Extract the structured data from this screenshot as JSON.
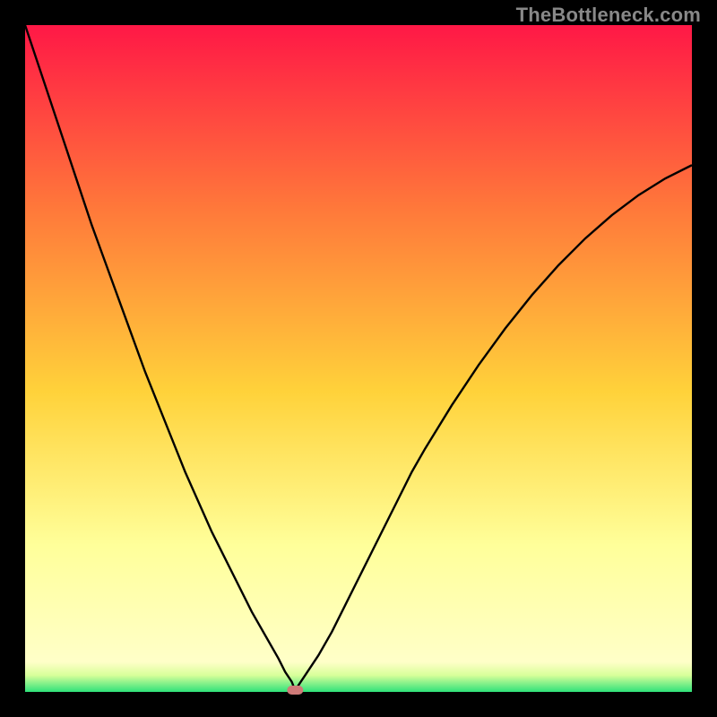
{
  "watermark": "TheBottleneck.com",
  "chart_data": {
    "type": "line",
    "title": "",
    "xlabel": "",
    "ylabel": "",
    "xlim": [
      0,
      100
    ],
    "ylim": [
      0,
      100
    ],
    "grid": false,
    "marker": {
      "x": 40.5,
      "y": 0,
      "color": "#cf7a78"
    },
    "colors": {
      "gradient_top": "#ff1846",
      "gradient_mid_upper": "#ff7a3a",
      "gradient_mid": "#ffd23a",
      "gradient_lower": "#ffff9a",
      "gradient_base": "#2fe27a",
      "frame": "#000000",
      "curve": "#000000"
    },
    "series": [
      {
        "name": "bottleneck-curve",
        "x": [
          0,
          2,
          4,
          6,
          8,
          10,
          12,
          14,
          16,
          18,
          20,
          22,
          24,
          26,
          28,
          30,
          32,
          34,
          36,
          38,
          39,
          40,
          40.5,
          41,
          42,
          44,
          46,
          48,
          50,
          52,
          54,
          56,
          58,
          60,
          64,
          68,
          72,
          76,
          80,
          84,
          88,
          92,
          96,
          100
        ],
        "y": [
          100,
          94,
          88,
          82,
          76,
          70,
          64.5,
          59,
          53.5,
          48,
          43,
          38,
          33,
          28.5,
          24,
          20,
          16,
          12,
          8.5,
          5,
          3,
          1.5,
          0.2,
          1.0,
          2.5,
          5.5,
          9,
          13,
          17,
          21,
          25,
          29,
          33,
          36.5,
          43,
          49,
          54.5,
          59.5,
          64,
          68,
          71.5,
          74.5,
          77,
          79
        ]
      }
    ]
  }
}
